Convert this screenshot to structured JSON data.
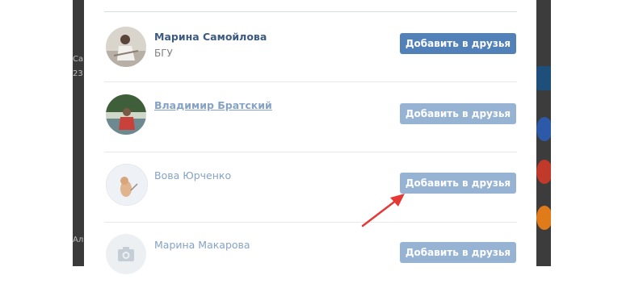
{
  "background": {
    "left_edge_texts": [
      "Са",
      "23",
      "Ал"
    ]
  },
  "friends_list": [
    {
      "name": "Марина Самойлова",
      "subtitle": "БГУ",
      "button_label": "Добавить в друзья",
      "name_color": "#3d5a80",
      "button_color": "#5181b8"
    },
    {
      "name": "Владимир Братский",
      "subtitle": "",
      "button_label": "Добавить в друзья",
      "name_color": "#86a3c5",
      "button_color": "#97b3d3"
    },
    {
      "name": "Вова Юрченко",
      "subtitle": "",
      "button_label": "Добавить в друзья",
      "name_color": "#86a3c5",
      "button_color": "#97b3d3"
    },
    {
      "name": "Марина Макарова",
      "subtitle": "",
      "button_label": "Добавить в друзья",
      "name_color": "#86a3c5",
      "button_color": "#97b3d3"
    }
  ],
  "icons": {
    "camera_placeholder": "camera-icon",
    "annotation": "red-arrow-icon"
  },
  "colors": {
    "accent": "#5181b8",
    "arrow": "#e53935"
  }
}
